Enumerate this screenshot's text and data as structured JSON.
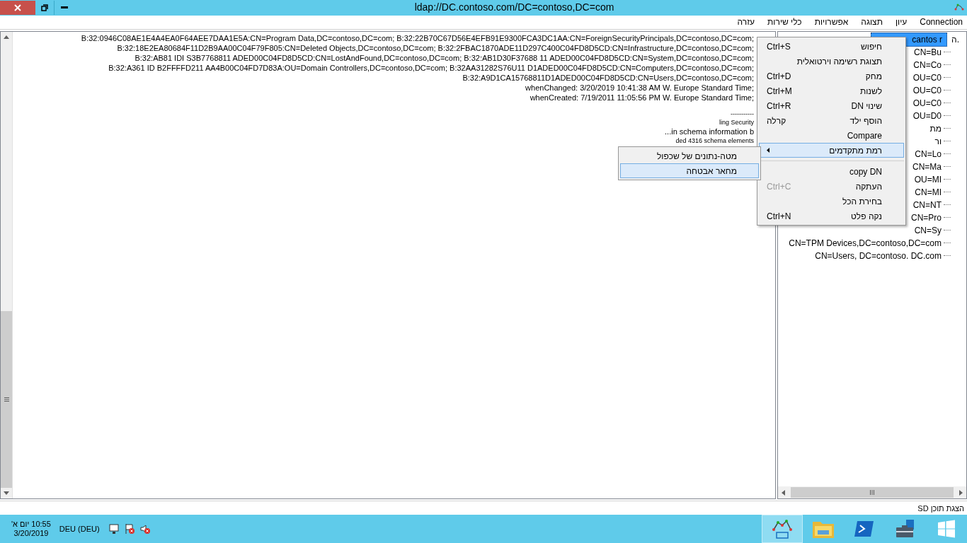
{
  "window": {
    "title": "ldap://DC.contoso.com/DC=contoso,DC=com"
  },
  "menu_bar": [
    "Connection",
    "עיון",
    "תצוגה",
    "אפשרויות",
    "כלי שירות",
    "עזרה"
  ],
  "output_lines": [
    {
      "kind": "text",
      "text": "B:32:0946C08AE1E4A4EA0F64AEE7DAA1E5A:CN=Program Data,DC=contoso,DC=com; B:32:22B70C67D56E4EFB91E9300FCA3DC1AA:CN=ForeignSecurityPrincipals,DC=contoso,DC=com;"
    },
    {
      "kind": "text",
      "text": "B:32:18E2EA80684F11D2B9AA00C04F79F805:CN=Deleted Objects,DC=contoso,DC=com; B:32:2FBAC1870ADE11D297C400C04FD8D5CD:CN=Infrastructure,DC=contoso,DC=com;"
    },
    {
      "kind": "text",
      "text": "B:32:AB81 IDI S3B7768811 ADED00C04FD8D5CD:CN=LostAndFound,DC=contoso,DC=com; B:32:AB1D30F37688 11 ADED00C04FD8D5CD:CN=System,DC=contoso,DC=com;"
    },
    {
      "kind": "text",
      "text": "B:32:A361 ID B2FFFFD211 AA4B00C04FD7D83A:OU=Domain Controllers,DC=contoso,DC=com; B:32AA31282S76U11 D1ADED00C04FD8D5CD:CN=Computers,DC=contoso,DC=com;"
    },
    {
      "kind": "text",
      "text": "B:32:A9D1CA15768811D1ADED00C04FD8D5CD:CN=Users,DC=contoso,DC=com;"
    },
    {
      "kind": "text",
      "text": "whenChanged: 3/20/2019 10:41:38 AM W. Europe Standard Time;"
    },
    {
      "kind": "text",
      "text": "whenCreated: 7/19/2011 11:05:56 PM W. Europe Standard Time;"
    },
    {
      "kind": "gap"
    },
    {
      "kind": "small",
      "text": "-----------"
    },
    {
      "kind": "small",
      "text": "ling Security"
    },
    {
      "kind": "text",
      "text": "...in schema information b"
    },
    {
      "kind": "small",
      "text": "ded 4316 schema elements"
    }
  ],
  "tree": [
    {
      "marker": "ה.",
      "label": "cantos r",
      "selected": true,
      "children": [
        {
          "label": "CN=Bu",
          "selected": false
        },
        {
          "label": "CN=Co",
          "selected": false
        },
        {
          "label": "OU=C0",
          "selected": false
        },
        {
          "label": "OU=C0",
          "selected": false
        },
        {
          "label": "OU=C0",
          "selected": false
        },
        {
          "label": "OU=D0",
          "selected": false
        },
        {
          "label": "מת",
          "selected": false
        },
        {
          "label": "ור",
          "selected": false
        },
        {
          "label": "CN=Lo",
          "selected": false
        },
        {
          "label": "CN=Ma",
          "selected": false
        },
        {
          "label": "OU=MI",
          "selected": false
        },
        {
          "label": "CN=MI",
          "selected": false
        },
        {
          "label": "CN=NT",
          "selected": false
        },
        {
          "label": "CN=Pro",
          "selected": false
        },
        {
          "label": "CN=Sy",
          "selected": false
        },
        {
          "label": "CN=TPM Devices,DC=contoso,DC=com",
          "selected": false
        },
        {
          "label": "CN=Users, DC=contoso. DC.com",
          "selected": false
        }
      ]
    }
  ],
  "context_menu": [
    {
      "kind": "item",
      "label": "חיפוש",
      "shortcut": "Ctrl+S",
      "selected": false
    },
    {
      "kind": "item",
      "label": "תצוגת רשימה וירטואלית",
      "selected": false
    },
    {
      "kind": "item",
      "label": "מחק",
      "shortcut": "Ctrl+D",
      "selected": false
    },
    {
      "kind": "item",
      "label": "לשנות",
      "shortcut": "Ctrl+M",
      "selected": false
    },
    {
      "kind": "item",
      "label": "שינוי DN",
      "shortcut": "Ctrl+R",
      "selected": false
    },
    {
      "kind": "item",
      "label": "הוסף ילד",
      "shortcut": "קרלה",
      "selected": false
    },
    {
      "kind": "item",
      "label": "Compare",
      "selected": false
    },
    {
      "kind": "submenu",
      "label": "רמת מתקדמים",
      "selected": true
    },
    {
      "kind": "separator"
    },
    {
      "kind": "item",
      "label": "copy DN",
      "selected": false
    },
    {
      "kind": "item",
      "label": "העתקה",
      "shortcut": "Ctrl+C",
      "shortcut_disabled": true,
      "selected": false
    },
    {
      "kind": "item",
      "label": "בחירת הכל",
      "selected": false
    },
    {
      "kind": "item",
      "label": "נקה פלט",
      "shortcut": "Ctrl+N",
      "selected": false
    }
  ],
  "submenu": [
    {
      "label": "מטה-נתונים של שכפול",
      "selected": false
    },
    {
      "label": "מחאר אבטחה",
      "selected": true
    }
  ],
  "status_bar": "הצגת תוכן SD",
  "taskbar": {
    "apps": [
      {
        "kind": "start",
        "active": false
      },
      {
        "kind": "server",
        "active": false
      },
      {
        "kind": "shell",
        "active": false
      },
      {
        "kind": "folder",
        "active": false
      },
      {
        "kind": "ldp",
        "active": true
      }
    ],
    "language": "DEU (DEU)",
    "time": "10:55 יום א'",
    "date": "3/20/2019"
  }
}
